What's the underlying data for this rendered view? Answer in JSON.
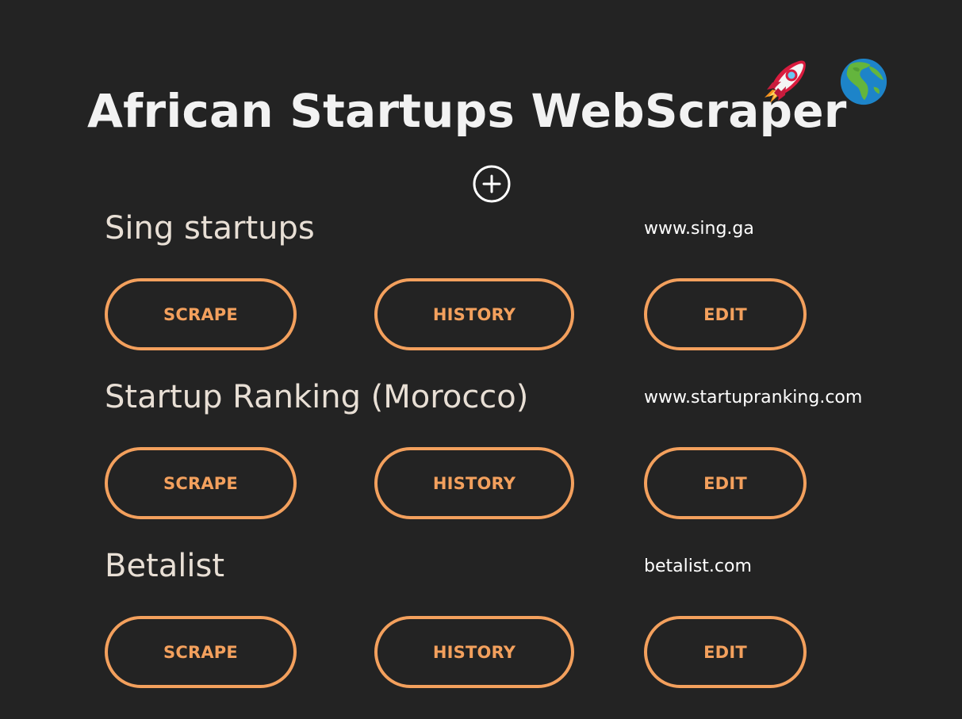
{
  "page": {
    "title": "African Startups WebScraper",
    "icons": {
      "rocket": "rocket-icon",
      "globe": "globe-africa-icon",
      "add": "plus-circle-icon"
    },
    "colors": {
      "background": "#232323",
      "accent": "#f3a05d",
      "title": "#f2f2f2",
      "site_name": "#e8dfd5",
      "url": "#ffffff"
    }
  },
  "sites": [
    {
      "name": "Sing startups",
      "url": "www.sing.ga",
      "actions": {
        "scrape": "SCRAPE",
        "history": "HISTORY",
        "edit": "EDIT"
      }
    },
    {
      "name": "Startup Ranking (Morocco)",
      "url": "www.startupranking.com",
      "actions": {
        "scrape": "SCRAPE",
        "history": "HISTORY",
        "edit": "EDIT"
      }
    },
    {
      "name": "Betalist",
      "url": "betalist.com",
      "actions": {
        "scrape": "SCRAPE",
        "history": "HISTORY",
        "edit": "EDIT"
      }
    }
  ]
}
